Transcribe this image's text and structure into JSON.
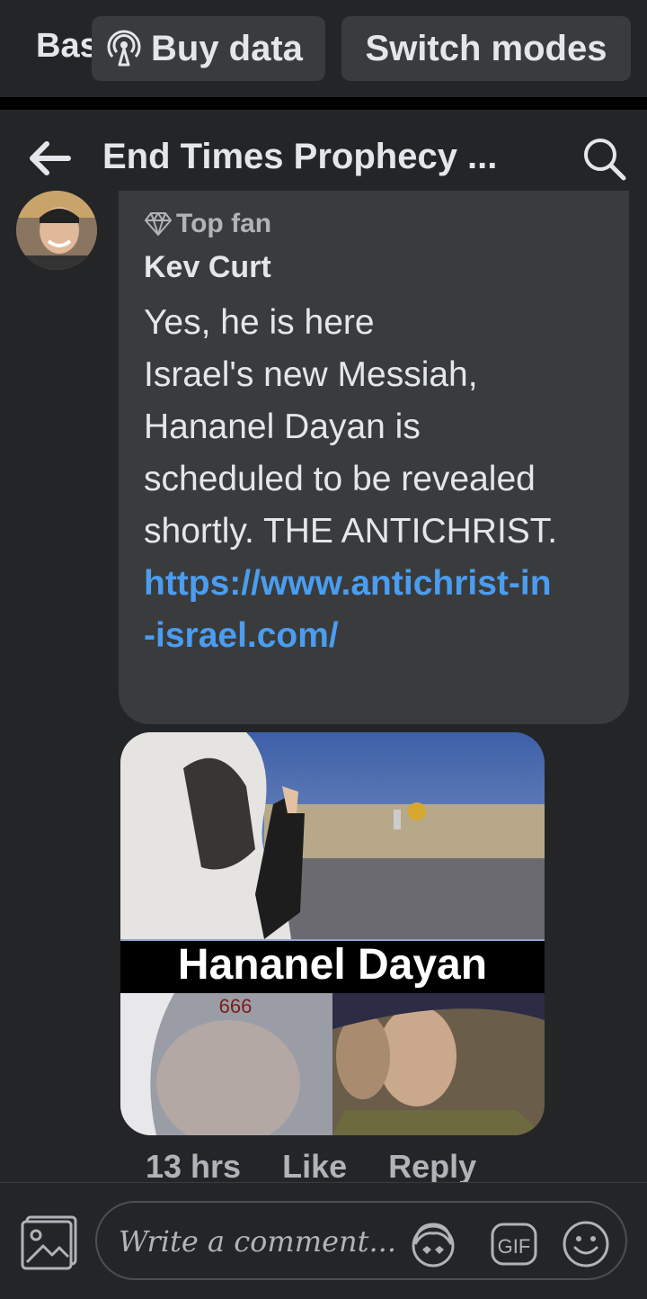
{
  "banner": {
    "label": "Bas",
    "buy_data": "Buy data",
    "switch_modes": "Switch modes"
  },
  "header": {
    "title": "End Times Prophecy ...",
    "back_icon": "back-arrow-icon",
    "search_icon": "search-icon"
  },
  "comment": {
    "badge": "Top fan",
    "author": "Kev Curt",
    "text": "Yes, he is here\nIsrael's new Messiah,\nHananel Dayan is\nscheduled to be revealed\nshortly. THE ANTICHRIST.\n",
    "link": "https://www.antichrist-in\n-israel.com/",
    "image": {
      "caption": "Hananel Dayan",
      "number": "666"
    },
    "time": "13 hrs",
    "like": "Like",
    "reply": "Reply"
  },
  "composer": {
    "placeholder": "Write a comment...",
    "gif": "GIF"
  },
  "colors": {
    "background": "#242527",
    "bubble": "#3a3b3c",
    "link": "#4a9df0",
    "text": "#e4e6eb",
    "muted": "#b0b3b8"
  }
}
